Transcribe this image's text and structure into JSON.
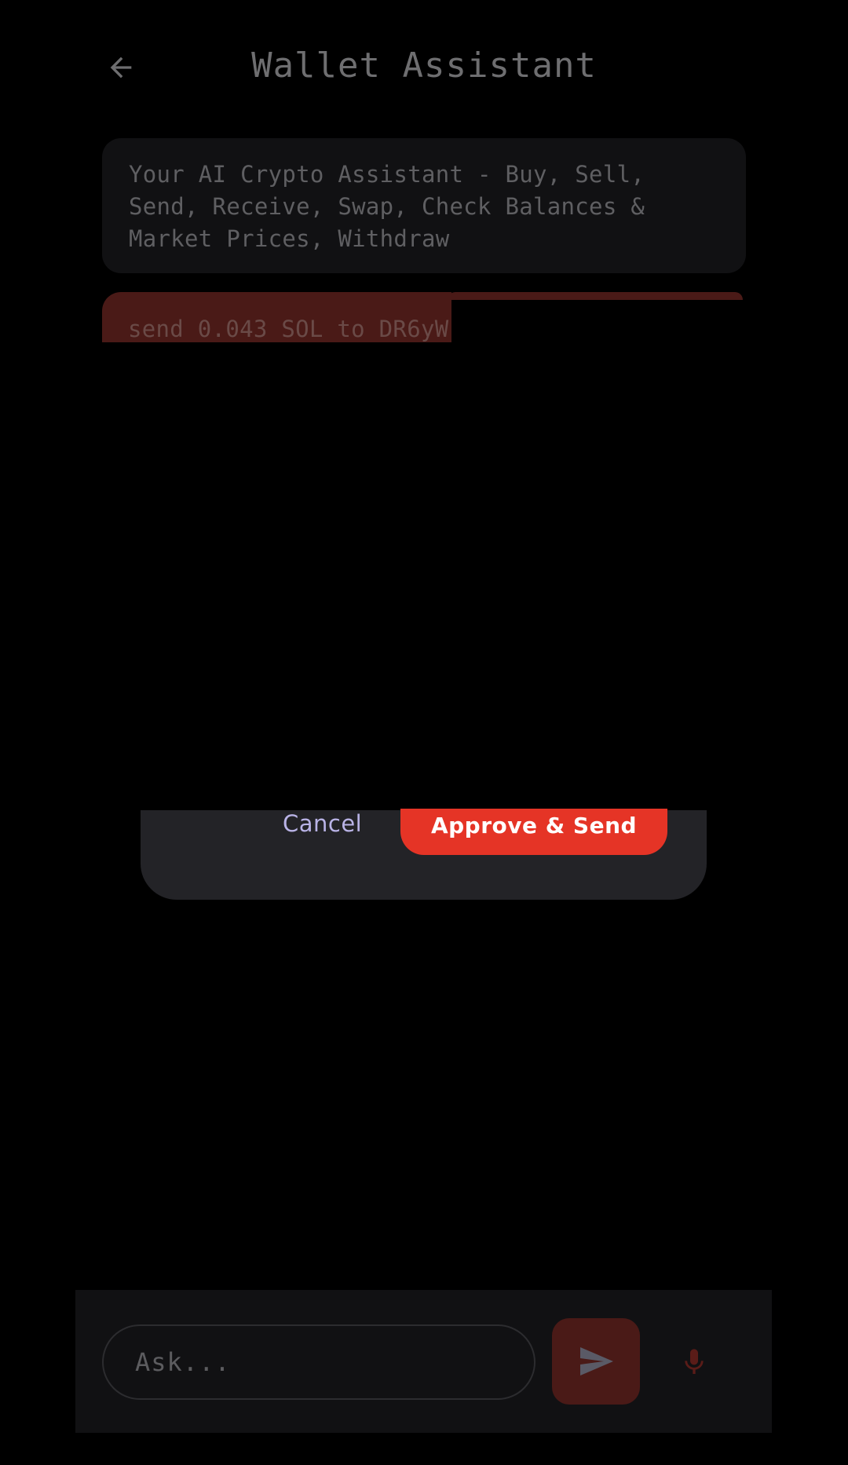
{
  "header": {
    "title": "Wallet Assistant",
    "back_icon": "arrow-left-icon"
  },
  "chat": {
    "intro_message": "Your AI Crypto Assistant - Buy, Sell, Send, Receive, Swap, Check Balances & Market Prices, Withdraw",
    "user_message": "send 0.043 SOL to DR6yW"
  },
  "dialog": {
    "cancel_label": "Cancel",
    "approve_label": "Approve & Send",
    "approve_color": "#e53426"
  },
  "input_bar": {
    "placeholder": "Ask...",
    "send_icon": "send-icon",
    "mic_icon": "microphone-icon"
  },
  "colors": {
    "background": "#000000",
    "accent": "#e53426"
  }
}
